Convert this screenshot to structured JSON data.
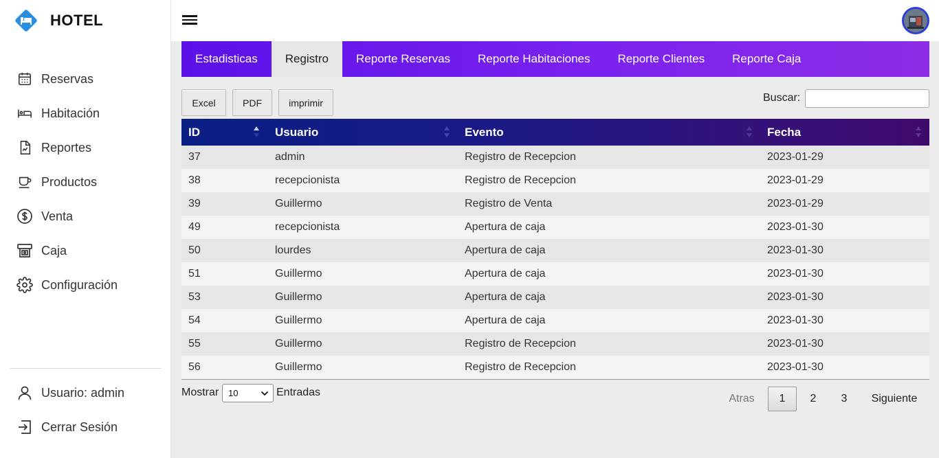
{
  "brand": {
    "title": "HOTEL",
    "logo_icon": "bed-icon",
    "accent": "#2b8fe0"
  },
  "sidebar": {
    "items": [
      {
        "label": "Reservas",
        "icon": "calendar-icon"
      },
      {
        "label": "Habitación",
        "icon": "bed-icon"
      },
      {
        "label": "Reportes",
        "icon": "report-file-icon"
      },
      {
        "label": "Productos",
        "icon": "cup-icon"
      },
      {
        "label": "Venta",
        "icon": "dollar-circle-icon"
      },
      {
        "label": "Caja",
        "icon": "cash-register-icon"
      },
      {
        "label": "Configuración",
        "icon": "gear-icon"
      }
    ],
    "bottom": [
      {
        "label": "Usuario: admin",
        "icon": "user-icon"
      },
      {
        "label": "Cerrar Sesión",
        "icon": "logout-icon"
      }
    ]
  },
  "tabs": [
    {
      "label": "Estadisticas",
      "active": false
    },
    {
      "label": "Registro",
      "active": true
    },
    {
      "label": "Reporte Reservas",
      "active": false
    },
    {
      "label": "Reporte Habitaciones",
      "active": false
    },
    {
      "label": "Reporte Clientes",
      "active": false
    },
    {
      "label": "Reporte Caja",
      "active": false
    }
  ],
  "toolbar": {
    "excel": "Excel",
    "pdf": "PDF",
    "print": "imprimir",
    "search_label": "Buscar:",
    "search_value": ""
  },
  "table": {
    "headers": [
      "ID",
      "Usuario",
      "Evento",
      "Fecha"
    ],
    "rows": [
      [
        "37",
        "admin",
        "Registro de Recepcion",
        "2023-01-29"
      ],
      [
        "38",
        "recepcionista",
        "Registro de Recepcion",
        "2023-01-29"
      ],
      [
        "39",
        "Guillermo",
        "Registro de Venta",
        "2023-01-29"
      ],
      [
        "49",
        "recepcionista",
        "Apertura de caja",
        "2023-01-30"
      ],
      [
        "50",
        "lourdes",
        "Apertura de caja",
        "2023-01-30"
      ],
      [
        "51",
        "Guillermo",
        "Apertura de caja",
        "2023-01-30"
      ],
      [
        "53",
        "Guillermo",
        "Apertura de caja",
        "2023-01-30"
      ],
      [
        "54",
        "Guillermo",
        "Apertura de caja",
        "2023-01-30"
      ],
      [
        "55",
        "Guillermo",
        "Registro de Recepcion",
        "2023-01-30"
      ],
      [
        "56",
        "Guillermo",
        "Registro de Recepcion",
        "2023-01-30"
      ]
    ]
  },
  "footer": {
    "show_label": "Mostrar",
    "page_size": "10",
    "entries_label": "Entradas",
    "prev": "Atras",
    "pages": [
      "1",
      "2",
      "3"
    ],
    "current_page": "1",
    "next": "Siguiente"
  }
}
